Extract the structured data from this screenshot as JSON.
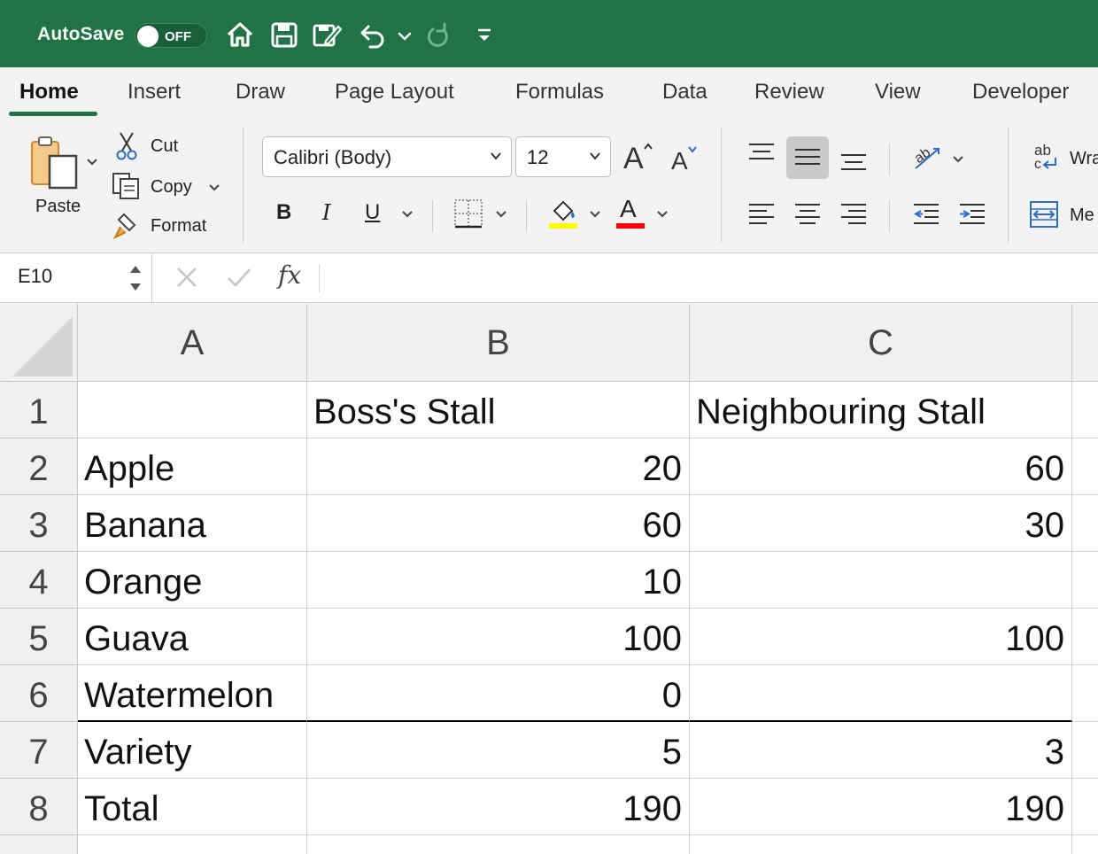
{
  "titlebar": {
    "autosave_label": "AutoSave",
    "autosave_state": "OFF",
    "accent_color": "#217346"
  },
  "tabs": [
    {
      "label": "Home",
      "active": true
    },
    {
      "label": "Insert"
    },
    {
      "label": "Draw"
    },
    {
      "label": "Page Layout"
    },
    {
      "label": "Formulas"
    },
    {
      "label": "Data"
    },
    {
      "label": "Review"
    },
    {
      "label": "View"
    },
    {
      "label": "Developer"
    }
  ],
  "ribbon": {
    "paste_label": "Paste",
    "cut_label": "Cut",
    "copy_label": "Copy",
    "format_label": "Format",
    "font_name": "Calibri (Body)",
    "font_size": "12",
    "bold": "B",
    "italic": "I",
    "underline": "U",
    "font_color_letter": "A",
    "highlight_color": "#ffff00",
    "font_color": "#ff0000",
    "wrap_label": "Wra",
    "merge_label": "Me",
    "wrap_icon_text": "ab"
  },
  "formula_bar": {
    "name_box": "E10",
    "fx": "fx",
    "formula": ""
  },
  "grid": {
    "columns": [
      "A",
      "B",
      "C"
    ],
    "rows": [
      {
        "num": "1",
        "a": "",
        "b": "Boss's Stall",
        "c": "Neighbouring Stall"
      },
      {
        "num": "2",
        "a": "Apple",
        "b": "20",
        "c": "60"
      },
      {
        "num": "3",
        "a": "Banana",
        "b": "60",
        "c": "30"
      },
      {
        "num": "4",
        "a": "Orange",
        "b": "10",
        "c": ""
      },
      {
        "num": "5",
        "a": "Guava",
        "b": "100",
        "c": "100"
      },
      {
        "num": "6",
        "a": "Watermelon",
        "b": "0",
        "c": ""
      },
      {
        "num": "7",
        "a": "Variety",
        "b": "5",
        "c": "3"
      },
      {
        "num": "8",
        "a": "Total",
        "b": "190",
        "c": "190"
      }
    ]
  }
}
